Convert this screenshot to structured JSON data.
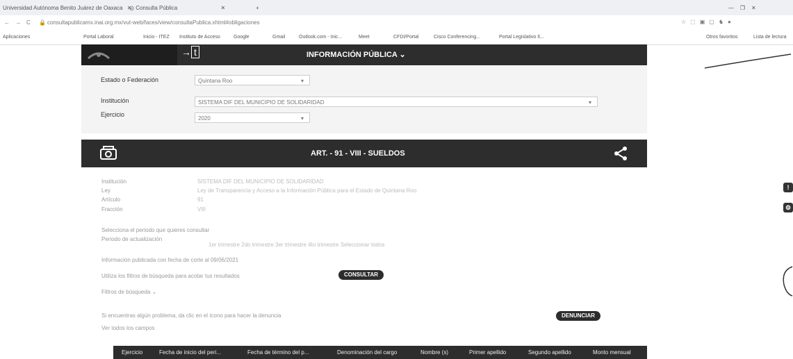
{
  "browser": {
    "tab1_label": "Universidad Autónoma Benito Juárez de Oaxaca",
    "tab2_label": "Consulta Pública",
    "url": "consultapublicamx.inai.org.mx/vut-web/faces/view/consultaPublica.xhtml#obligaciones",
    "bookmarks": [
      "Aplicaciones",
      "Portal Laboral",
      "Inicio - ITEZ",
      "Instituto de Acceso",
      "Google",
      "Gmail",
      "Outlook.com - Inic...",
      "Meet",
      "CFDI/Portal",
      "Cisco Conferencing...",
      "Portal Legislativo Il...",
      "Otros favoritos",
      "Lista de lectura"
    ]
  },
  "topbar": {
    "title": "INFORMACIÓN PÚBLICA"
  },
  "form": {
    "estado_label": "Estado o Federación",
    "estado_value": "Quintana Roo",
    "institucion_label": "Institución",
    "institucion_value": "SISTEMA DIF DEL MUNICIPIO DE SOLIDARIDAD",
    "ejercicio_label": "Ejercicio",
    "ejercicio_value": "2020"
  },
  "article": {
    "title": "ART. - 91 - VIII - SUELDOS"
  },
  "details": {
    "institucion_label": "Institución",
    "institucion_value": "SISTEMA DIF DEL MUNICIPIO DE SOLIDARIDAD",
    "ley_label": "Ley",
    "ley_value": "Ley de Transparencia y Acceso a la Información Pública para el Estado de Quintana Roo",
    "articulo_label": "Artículo",
    "articulo_value": "91",
    "fraccion_label": "Fracción",
    "fraccion_value": "VIII",
    "periodo_hint": "Selecciona el periodo que quieres consultar",
    "periodo_label": "Periodo de actualización",
    "periodo_options": "1er trimestre   2do trimestre   3er trimestre   4to trimestre   Seleccionar todos",
    "info_hint": "Información publicada con fecha de corte al 09/06/2021",
    "filters_hint": "Utiliza los filtros de búsqueda para acotar tus resultados",
    "consultar": "CONSULTAR",
    "filtros_label": "Filtros de búsqueda",
    "denuncia_hint": "Si encuentras algún problema, da clic en el ícono para hacer la denuncia",
    "denunciar": "DENUNCIAR",
    "total_label": "Ver todos los campos"
  },
  "table": {
    "headers": [
      "Ejercicio",
      "Fecha de inicio del peri...",
      "Fecha de término del p...",
      "Denominación del cargo",
      "Nombre (s)",
      "Primer apellido",
      "Segundo apellido",
      "Monto mensual"
    ]
  }
}
